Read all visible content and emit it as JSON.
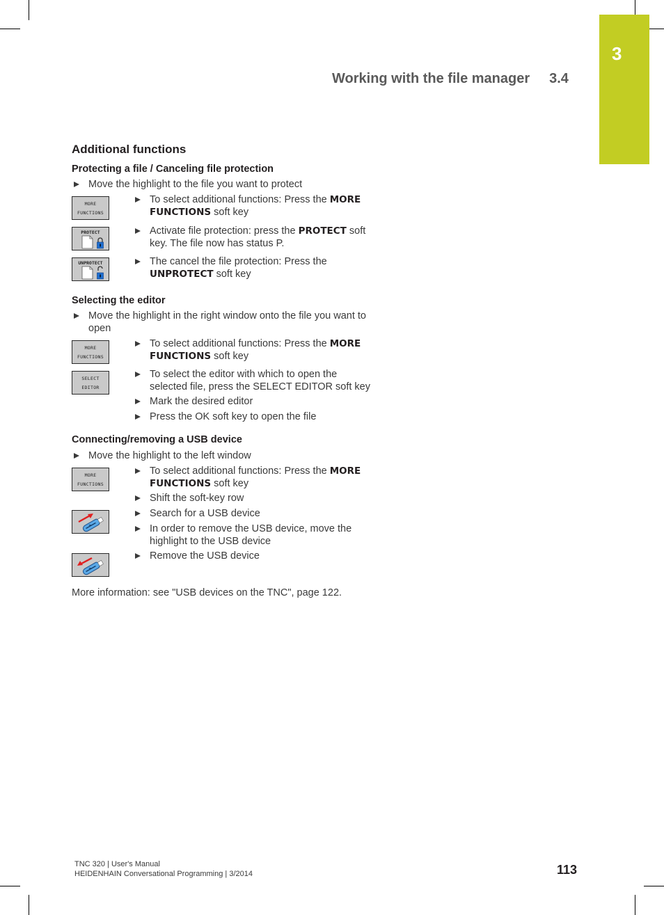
{
  "header": {
    "title": "Working with the file manager",
    "section": "3.4",
    "chapter": "3"
  },
  "colors": {
    "chapter_tab": "#c2cd23",
    "softkey_bg": "#c9c9c9",
    "lock_blue": "#1f6fd0",
    "usb_arrow_red": "#e02020",
    "usb_stick_blue": "#5aa8e6"
  },
  "content": {
    "heading": "Additional functions",
    "sections": [
      {
        "title": "Protecting a file / Canceling file protection",
        "intro": "Move the highlight to the file you want to protect",
        "steps": [
          {
            "pre": "To select additional functions: Press the ",
            "bold1": "MORE",
            "bold2": "FUNCTIONS",
            "post": " soft key"
          },
          {
            "pre": "Activate file protection: press the ",
            "bold1": "PROTECT",
            "mid": " soft",
            "line2": "key. The file now has status P."
          },
          {
            "pre": "The cancel the file protection: Press the",
            "bold2": "UNPROTECT",
            "post": " soft key"
          }
        ],
        "softkeys": [
          {
            "line1": "MORE",
            "line2": "FUNCTIONS",
            "icon": "more-functions-icon"
          },
          {
            "line1": "PROTECT",
            "icon": "lock-closed-icon"
          },
          {
            "line1": "UNPROTECT",
            "icon": "lock-open-icon"
          }
        ]
      },
      {
        "title": "Selecting the editor",
        "intro_line1": "Move the highlight in the right window onto the file you want to",
        "intro_line2": "open",
        "steps": [
          {
            "pre": "To select additional functions: Press the ",
            "bold1": "MORE",
            "bold2": "FUNCTIONS",
            "post": " soft key"
          },
          {
            "line1": "To select the editor with which to open the",
            "line2": "selected file, press the SELECT EDITOR soft key"
          },
          {
            "text": "Mark the desired editor"
          },
          {
            "text": "Press the OK soft key to open the file"
          }
        ],
        "softkeys": [
          {
            "line1": "MORE",
            "line2": "FUNCTIONS"
          },
          {
            "line1": "SELECT",
            "line2": "EDITOR"
          }
        ]
      },
      {
        "title": "Connecting/removing a USB device",
        "intro": "Move the highlight to the left window",
        "steps": [
          {
            "pre": "To select additional functions: Press the ",
            "bold1": "MORE",
            "bold2": "FUNCTIONS",
            "post": " soft key"
          },
          {
            "text": "Shift the soft-key row"
          },
          {
            "text": "Search for a USB device"
          },
          {
            "line1": "In order to remove the USB device, move the",
            "line2": "highlight to the USB device"
          },
          {
            "text": "Remove the USB device"
          }
        ],
        "softkeys": [
          {
            "line1": "MORE",
            "line2": "FUNCTIONS"
          },
          {
            "icon": "usb-connect-icon"
          },
          {
            "icon": "usb-remove-icon"
          }
        ]
      }
    ],
    "more_info": "More information: see \"USB devices on the TNC\", page 122."
  },
  "footer": {
    "line1": "TNC 320 | User's Manual",
    "line2": "HEIDENHAIN Conversational Programming | 3/2014",
    "page_number": "113"
  }
}
